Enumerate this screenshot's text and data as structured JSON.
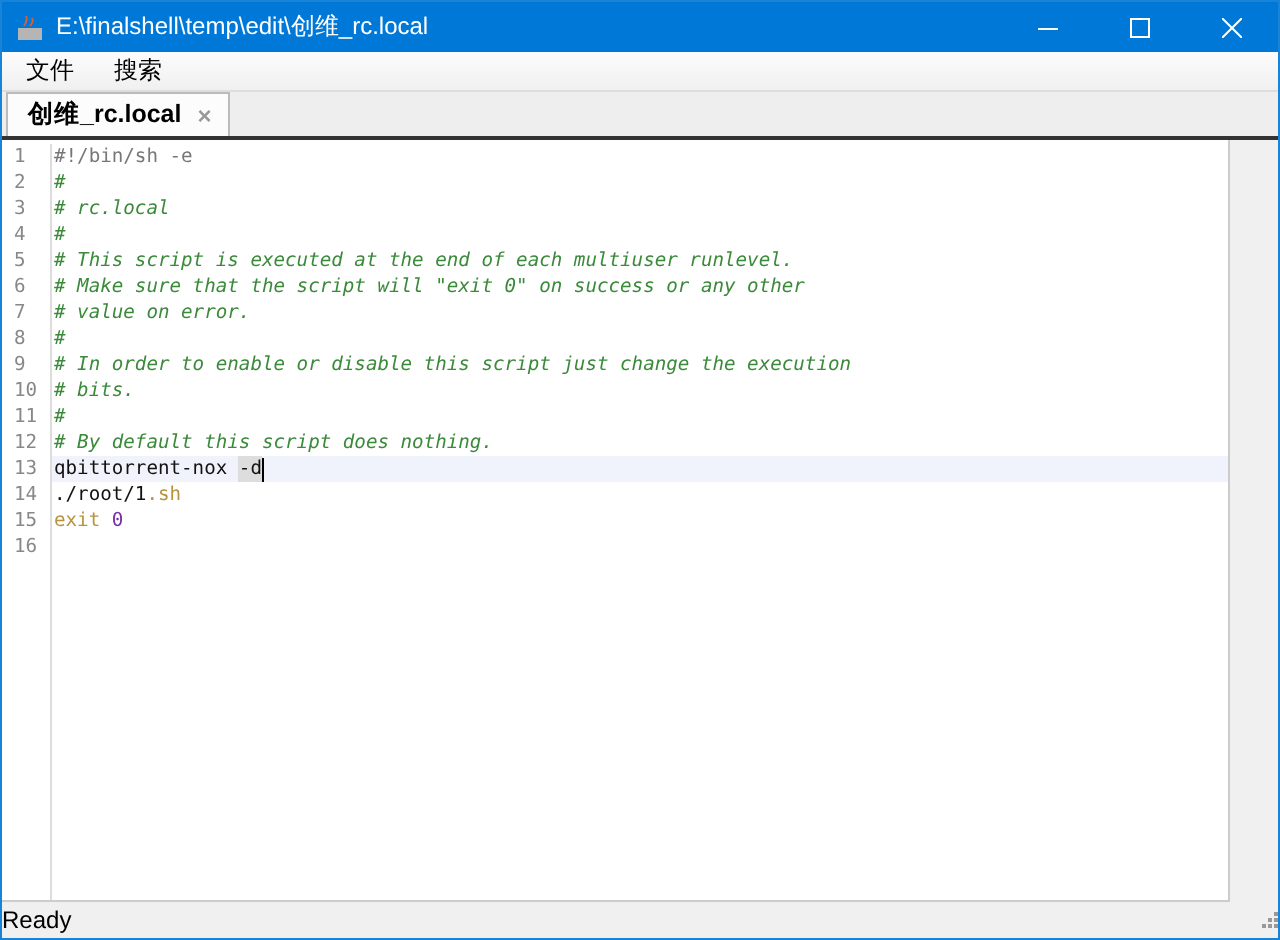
{
  "window": {
    "title": "E:\\finalshell\\temp\\edit\\创维_rc.local"
  },
  "menu": [
    "文件",
    "搜索"
  ],
  "tabs": [
    {
      "label": "创维_rc.local",
      "selected": true,
      "close": "×"
    }
  ],
  "editor": {
    "lines": [
      {
        "number": "1",
        "current": false,
        "tokens": [
          {
            "kind": "shebang",
            "text": "#!/bin/sh -e"
          }
        ]
      },
      {
        "number": "2",
        "current": false,
        "tokens": [
          {
            "kind": "comment",
            "text": "#"
          }
        ]
      },
      {
        "number": "3",
        "current": false,
        "tokens": [
          {
            "kind": "comment",
            "text": "# rc.local"
          }
        ]
      },
      {
        "number": "4",
        "current": false,
        "tokens": [
          {
            "kind": "comment",
            "text": "#"
          }
        ]
      },
      {
        "number": "5",
        "current": false,
        "tokens": [
          {
            "kind": "comment",
            "text": "# This script is executed at the end of each multiuser runlevel."
          }
        ]
      },
      {
        "number": "6",
        "current": false,
        "tokens": [
          {
            "kind": "comment",
            "text": "# Make sure that the script will \"exit 0\" on success or any other"
          }
        ]
      },
      {
        "number": "7",
        "current": false,
        "tokens": [
          {
            "kind": "comment",
            "text": "# value on error."
          }
        ]
      },
      {
        "number": "8",
        "current": false,
        "tokens": [
          {
            "kind": "comment",
            "text": "#"
          }
        ]
      },
      {
        "number": "9",
        "current": false,
        "tokens": [
          {
            "kind": "comment",
            "text": "# In order to enable or disable this script just change the execution"
          }
        ]
      },
      {
        "number": "10",
        "current": false,
        "tokens": [
          {
            "kind": "comment",
            "text": "# bits."
          }
        ]
      },
      {
        "number": "11",
        "current": false,
        "tokens": [
          {
            "kind": "comment",
            "text": "#"
          }
        ]
      },
      {
        "number": "12",
        "current": false,
        "tokens": [
          {
            "kind": "comment",
            "text": "# By default this script does nothing."
          }
        ]
      },
      {
        "number": "13",
        "current": true,
        "tokens": [
          {
            "kind": "plain",
            "text": "qbittorrent-nox "
          },
          {
            "kind": "marked",
            "text": "-d"
          }
        ]
      },
      {
        "number": "14",
        "current": false,
        "tokens": [
          {
            "kind": "plain",
            "text": "./root/1"
          },
          {
            "kind": "extension",
            "text": ".sh"
          }
        ]
      },
      {
        "number": "15",
        "current": false,
        "tokens": [
          {
            "kind": "keyword",
            "text": "exit "
          },
          {
            "kind": "number",
            "text": "0"
          }
        ]
      },
      {
        "number": "16",
        "current": false
      }
    ]
  },
  "status_bar": "Ready"
}
